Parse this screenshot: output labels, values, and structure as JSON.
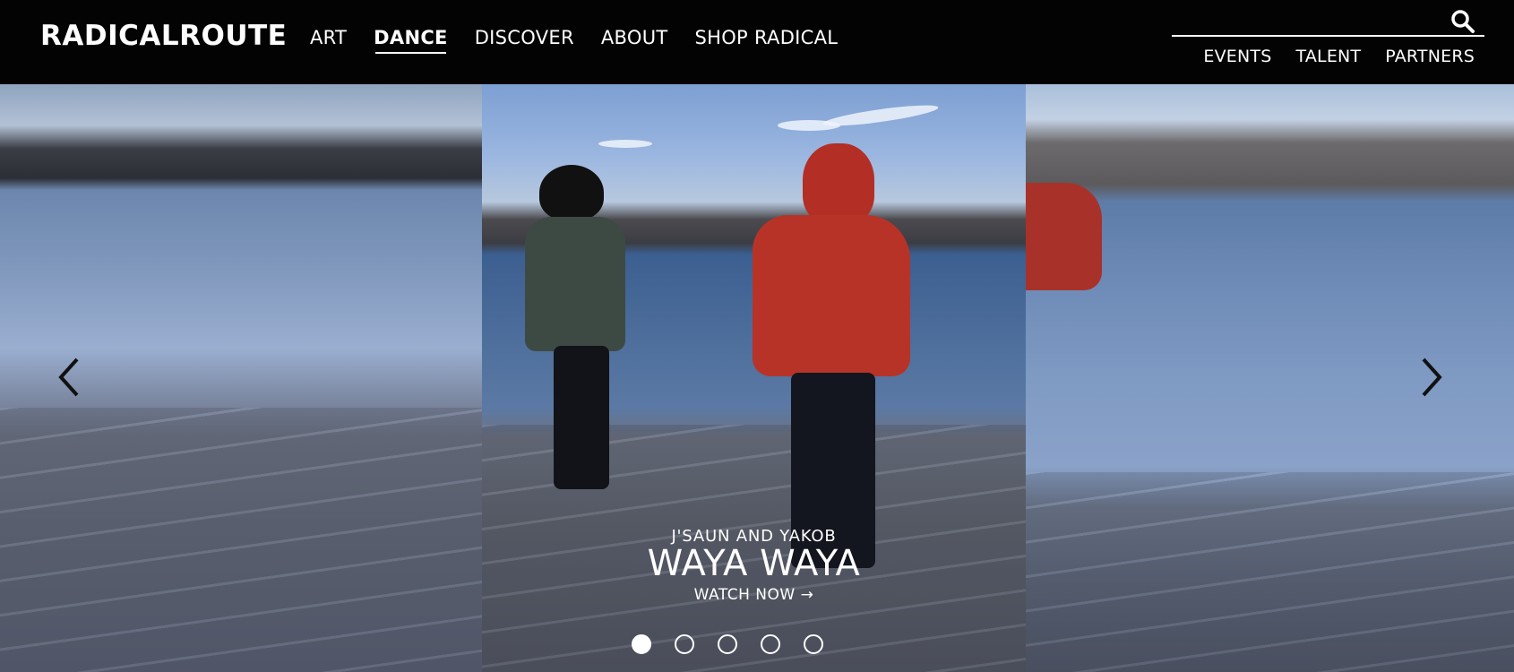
{
  "brand": {
    "logo_text": "RADICALROUTE"
  },
  "main_nav": {
    "items": [
      {
        "label": "ART"
      },
      {
        "label": "DANCE",
        "active": true
      },
      {
        "label": "DISCOVER"
      },
      {
        "label": "ABOUT"
      },
      {
        "label": "SHOP RADICAL"
      }
    ]
  },
  "search": {
    "placeholder": "",
    "value": "",
    "icon": "search-icon"
  },
  "secondary_nav": {
    "items": [
      {
        "label": "EVENTS"
      },
      {
        "label": "TALENT"
      },
      {
        "label": "PARTNERS"
      }
    ]
  },
  "hero": {
    "artist": "J'SAUN AND YAKOB",
    "title": "WAYA WAYA",
    "cta": "WATCH NOW →",
    "prev_icon": "chevron-left-icon",
    "next_icon": "chevron-right-icon",
    "slide_count": 5,
    "active_slide": 1
  },
  "colors": {
    "header_bg": "#030303",
    "text": "#ffffff"
  }
}
